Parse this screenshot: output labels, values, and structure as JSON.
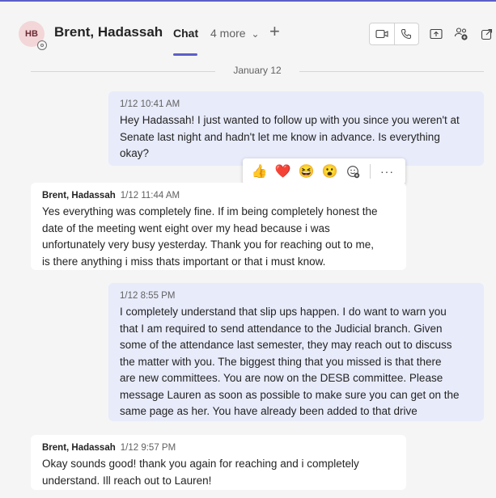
{
  "header": {
    "avatar_initials": "HB",
    "contact_name": "Brent, Hadassah",
    "active_tab": "Chat",
    "more_tabs": "4 more",
    "more_tabs_chevron": "⌄",
    "add_tab_symbol": "+",
    "icons": [
      "video-call-icon",
      "audio-call-icon",
      "share-screen-icon",
      "add-people-icon",
      "pop-out-icon"
    ],
    "accent_color": "#5b5fc7"
  },
  "date_divider": "January 12",
  "messages": [
    {
      "sender": "",
      "time": "1/12 10:41 AM",
      "text": "Hey Hadassah! I just wanted to follow up with you since you weren't at Senate last night and hadn't let me know in advance. Is everything okay?",
      "lines": [
        "Hey Hadassah! I just wanted to follow up with you since you weren't at",
        "Senate last night and hadn't let me know in advance. Is everything",
        "okay?"
      ]
    },
    {
      "sender": "Brent, Hadassah",
      "time": "1/12 11:44 AM",
      "lines": [
        "Yes everything was completely fine. If im being completely honest the",
        "date of the meeting went eight over my head because i was",
        "unfortunately very busy yesterday. Thank you for reaching out to me,",
        "is there anything i miss thats important or that i must know."
      ]
    },
    {
      "sender": "",
      "time": "1/12 8:55 PM",
      "lines": [
        "I completely understand that slip ups happen. I do want to warn you",
        "that I am required to send attendance to the Judicial branch. Given",
        "some of the attendance last semester, they may reach out to discuss",
        "the matter with you. The biggest thing that you missed is that there",
        "are new committees. You are now on the DESB committee. Please",
        "message Lauren as soon as possible to make sure you can get on the",
        "same page as her. You have already been added to that drive"
      ]
    },
    {
      "sender": "Brent, Hadassah",
      "time": "1/12 9:57 PM",
      "lines": [
        "Okay sounds good! thank you again for reaching and i completely",
        "understand. Ill reach out to Lauren!"
      ]
    }
  ],
  "reactions": {
    "items": [
      "👍",
      "❤️",
      "😆",
      "😮"
    ],
    "add_reaction_icon": "add-reaction-icon",
    "more_options": "···"
  }
}
